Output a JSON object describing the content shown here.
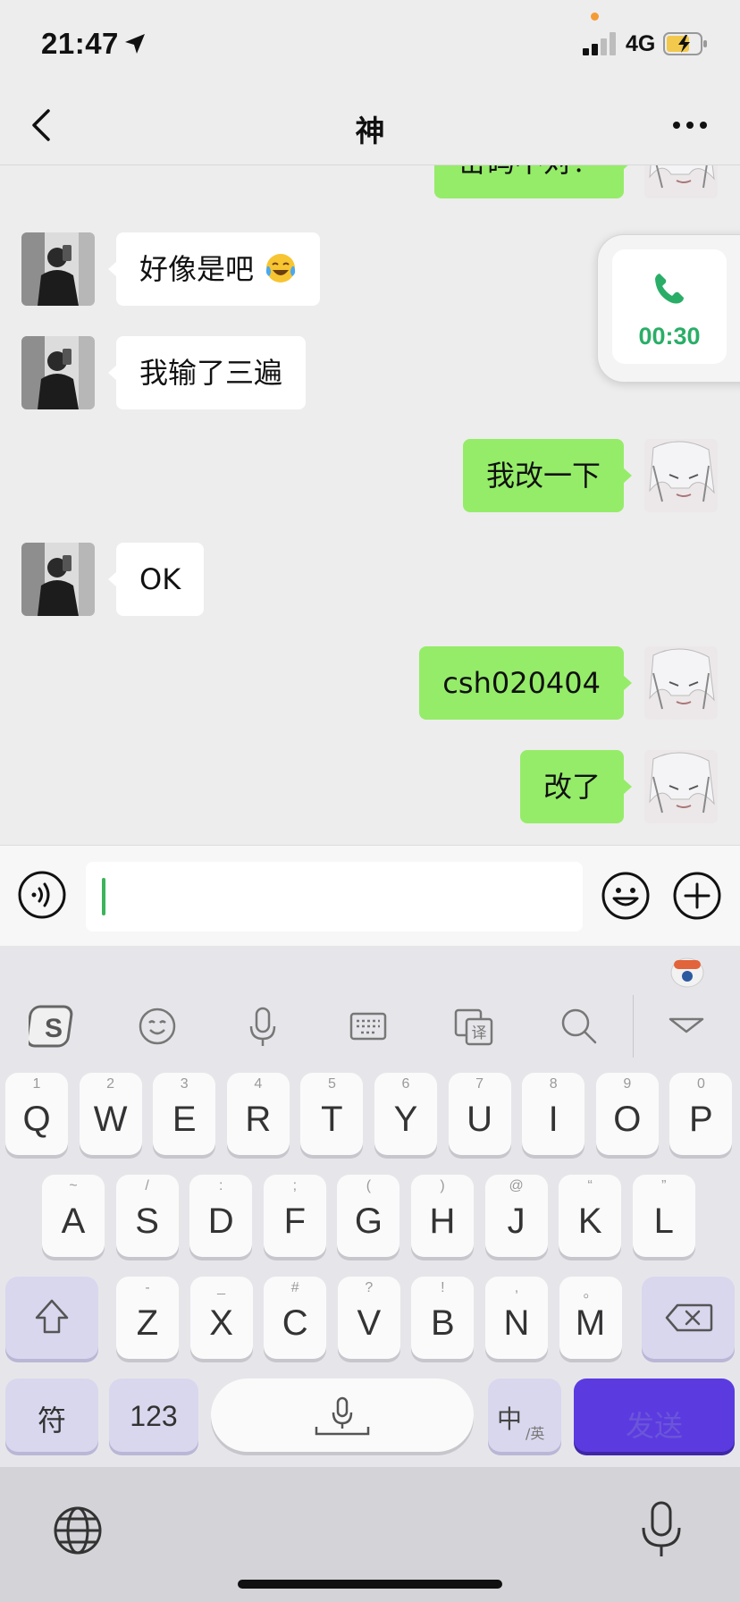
{
  "status_bar": {
    "time": "21:47",
    "network": "4G"
  },
  "nav": {
    "title": "神"
  },
  "messages": [
    {
      "side": "right",
      "text": "密码不对？"
    },
    {
      "side": "left",
      "text": "好像是吧"
    },
    {
      "side": "left",
      "text": "我输了三遍"
    },
    {
      "side": "right",
      "text": "我改一下"
    },
    {
      "side": "left",
      "text": "OK"
    },
    {
      "side": "right",
      "text": "csh020404"
    },
    {
      "side": "right",
      "text": "改了"
    }
  ],
  "call_float": {
    "duration": "00:30"
  },
  "keyboard": {
    "row1": [
      {
        "k": "Q",
        "s": "1"
      },
      {
        "k": "W",
        "s": "2"
      },
      {
        "k": "E",
        "s": "3"
      },
      {
        "k": "R",
        "s": "4"
      },
      {
        "k": "T",
        "s": "5"
      },
      {
        "k": "Y",
        "s": "6"
      },
      {
        "k": "U",
        "s": "7"
      },
      {
        "k": "I",
        "s": "8"
      },
      {
        "k": "O",
        "s": "9"
      },
      {
        "k": "P",
        "s": "0"
      }
    ],
    "row2": [
      {
        "k": "A",
        "s": "~"
      },
      {
        "k": "S",
        "s": "/"
      },
      {
        "k": "D",
        "s": ":"
      },
      {
        "k": "F",
        "s": ";"
      },
      {
        "k": "G",
        "s": "("
      },
      {
        "k": "H",
        "s": ")"
      },
      {
        "k": "J",
        "s": "@"
      },
      {
        "k": "K",
        "s": "“"
      },
      {
        "k": "L",
        "s": "”"
      }
    ],
    "row3": [
      {
        "k": "Z",
        "s": "-"
      },
      {
        "k": "X",
        "s": "_"
      },
      {
        "k": "C",
        "s": "#"
      },
      {
        "k": "V",
        "s": "?"
      },
      {
        "k": "B",
        "s": "!"
      },
      {
        "k": "N",
        "s": ","
      },
      {
        "k": "M",
        "s": "。"
      }
    ],
    "fu_label": "符",
    "num_label": "123",
    "zh_label": "中",
    "en_label": "/英",
    "send_label": "发送"
  }
}
